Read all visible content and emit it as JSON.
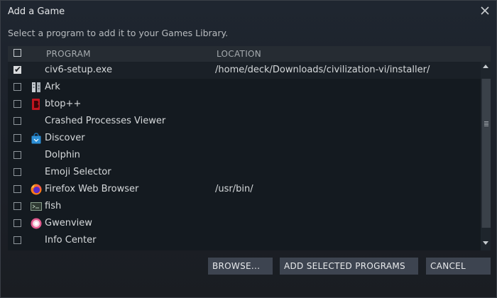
{
  "dialog": {
    "title": "Add a Game",
    "subtitle": "Select a program to add it to your Games Library."
  },
  "table": {
    "header_program": "PROGRAM",
    "header_location": "LOCATION",
    "rows": [
      {
        "name": "civ6-setup.exe",
        "location": "/home/deck/Downloads/civilization-vi/installer/",
        "checked": true,
        "icon": "none"
      },
      {
        "name": "Ark",
        "location": "",
        "checked": false,
        "icon": "ark-archive-icon"
      },
      {
        "name": "btop++",
        "location": "",
        "checked": false,
        "icon": "btop-icon"
      },
      {
        "name": "Crashed Processes Viewer",
        "location": "",
        "checked": false,
        "icon": "none"
      },
      {
        "name": "Discover",
        "location": "",
        "checked": false,
        "icon": "discover-bag-icon"
      },
      {
        "name": "Dolphin",
        "location": "",
        "checked": false,
        "icon": "none"
      },
      {
        "name": "Emoji Selector",
        "location": "",
        "checked": false,
        "icon": "none"
      },
      {
        "name": "Firefox Web Browser",
        "location": "/usr/bin/",
        "checked": false,
        "icon": "firefox-icon"
      },
      {
        "name": "fish",
        "location": "",
        "checked": false,
        "icon": "fish-terminal-icon"
      },
      {
        "name": "Gwenview",
        "location": "",
        "checked": false,
        "icon": "gwenview-icon"
      },
      {
        "name": "Info Center",
        "location": "",
        "checked": false,
        "icon": "none"
      }
    ]
  },
  "buttons": {
    "browse": "BROWSE...",
    "add_selected": "ADD SELECTED PROGRAMS",
    "cancel": "CANCEL"
  },
  "colors": {
    "background": "#1c2028",
    "list_background": "#141a20",
    "header_background": "#262c33",
    "button_background": "#3d4450",
    "btop_red": "#c0151f",
    "firefox_orange": "#ff7a18",
    "discover_blue": "#2d8fd6",
    "gwenview_pink": "#e35b8f"
  }
}
